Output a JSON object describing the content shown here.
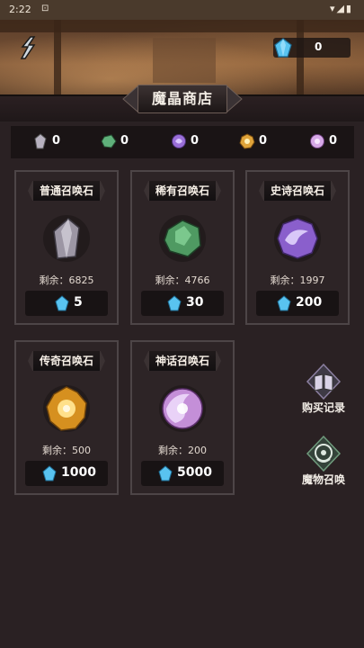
{
  "status_bar": {
    "time": "2:22",
    "notif": "⊡",
    "right": "▾◢▮"
  },
  "header": {
    "crystal_count": "0",
    "title": "魔晶商店"
  },
  "resources": [
    {
      "name": "普通召唤石",
      "count": "0",
      "color": "#b8b2c0"
    },
    {
      "name": "稀有召唤石",
      "count": "0",
      "color": "#5fb07a"
    },
    {
      "name": "史诗召唤石",
      "count": "0",
      "color": "#9a6fd8"
    },
    {
      "name": "传奇召唤石",
      "count": "0",
      "color": "#e0a43a"
    },
    {
      "name": "神话召唤石",
      "count": "0",
      "color": "#d7a9e8"
    }
  ],
  "cards": [
    {
      "title": "普通召唤石",
      "remaining": "剩余：6825",
      "price": "5"
    },
    {
      "title": "稀有召唤石",
      "remaining": "剩余：4766",
      "price": "30"
    },
    {
      "title": "史诗召唤石",
      "remaining": "剩余：1997",
      "price": "200"
    },
    {
      "title": "传奇召唤石",
      "remaining": "剩余：500",
      "price": "1000"
    },
    {
      "title": "神话召唤石",
      "remaining": "剩余：200",
      "price": "5000"
    }
  ],
  "side_buttons": {
    "purchase_history": "购买记录",
    "monster_summon": "魔物召唤"
  },
  "colors": {
    "gem_blue": "#59c3f0",
    "panel": "#2d2426",
    "bg": "#2a2123"
  }
}
